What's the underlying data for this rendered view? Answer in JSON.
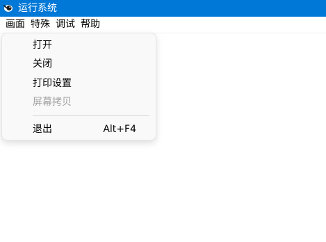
{
  "window": {
    "title": "运行系统",
    "icon": "eye-icon"
  },
  "menubar": {
    "items": [
      {
        "label": "画面"
      },
      {
        "label": "特殊"
      },
      {
        "label": "调试"
      },
      {
        "label": "帮助"
      }
    ]
  },
  "dropdown": {
    "items": [
      {
        "label": "打开",
        "enabled": true
      },
      {
        "label": "关闭",
        "enabled": true
      },
      {
        "label": "打印设置",
        "enabled": true
      },
      {
        "label": "屏幕拷贝",
        "enabled": false
      },
      {
        "label": "退出",
        "shortcut": "Alt+F4",
        "enabled": true
      }
    ]
  },
  "colors": {
    "titlebar": "#0078d7",
    "menu_background": "#f9f9f9",
    "disabled_text": "#a0a0a0"
  }
}
